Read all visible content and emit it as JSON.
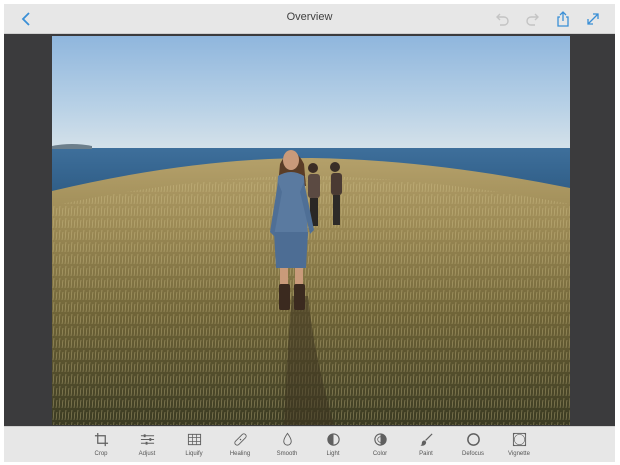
{
  "topbar": {
    "title": "Overview",
    "icons": [
      "back-chevron-icon",
      "undo-icon",
      "redo-icon",
      "share-icon",
      "expand-icon"
    ]
  },
  "colors": {
    "bar_background": "#e7e7e7",
    "workspace_background": "#3b3b3d",
    "accent_blue": "#3a8fd6",
    "icon_gray": "#606060"
  },
  "toolbar": {
    "tools": [
      {
        "label": "Crop",
        "icon": "crop-icon"
      },
      {
        "label": "Adjust",
        "icon": "sliders-icon"
      },
      {
        "label": "Liquify",
        "icon": "grid-icon"
      },
      {
        "label": "Healing",
        "icon": "bandage-icon"
      },
      {
        "label": "Smooth",
        "icon": "droplet-icon"
      },
      {
        "label": "Light",
        "icon": "half-circle-icon"
      },
      {
        "label": "Color",
        "icon": "color-circle-icon"
      },
      {
        "label": "Paint",
        "icon": "brush-icon"
      },
      {
        "label": "Defocus",
        "icon": "ring-icon"
      },
      {
        "label": "Vignette",
        "icon": "vignette-icon"
      }
    ]
  }
}
